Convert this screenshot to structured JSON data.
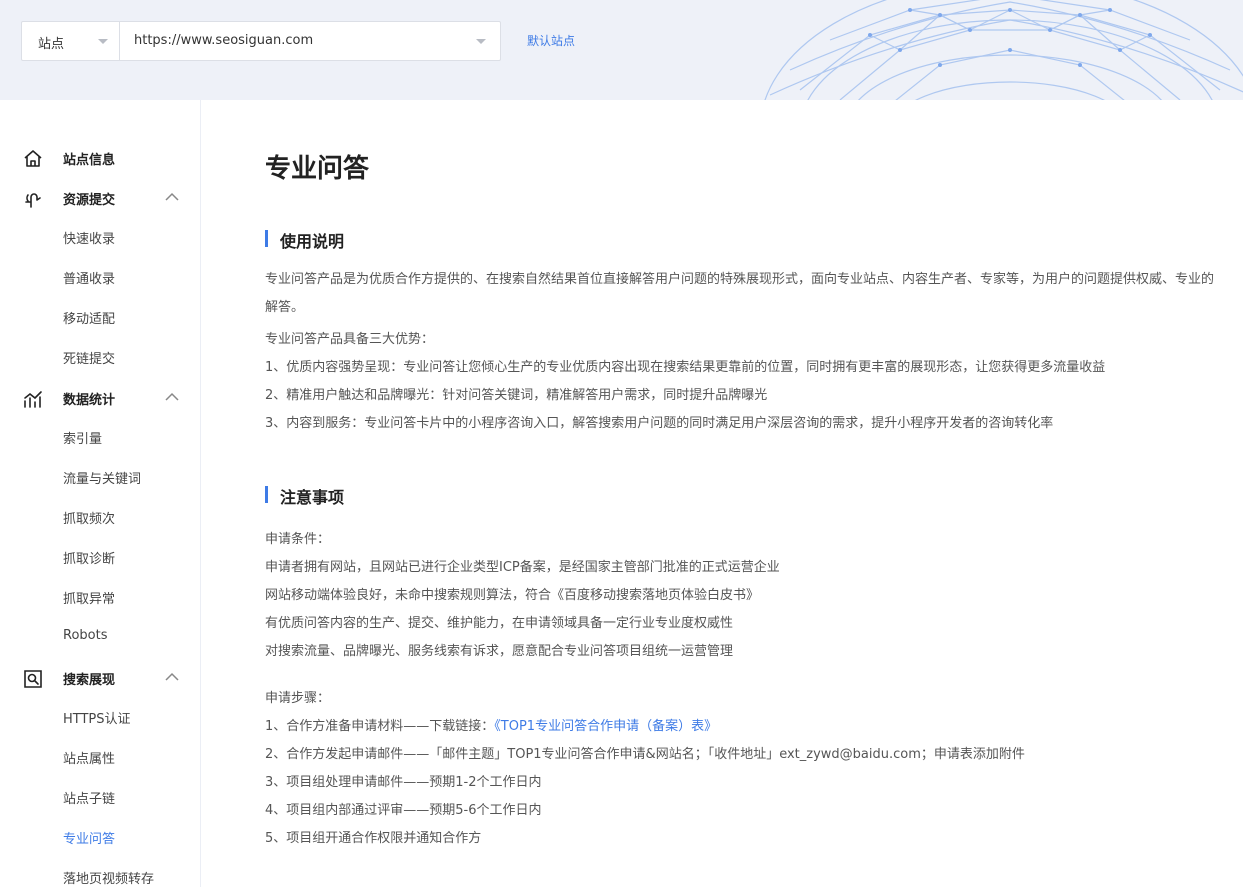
{
  "header": {
    "site_type_label": "站点",
    "site_url": "https://www.seosiguan.com",
    "default_site_link": "默认站点"
  },
  "sidebar": {
    "groups": [
      {
        "label": "站点信息",
        "icon": "home-icon",
        "expanded": null
      },
      {
        "label": "资源提交",
        "icon": "submit-icon",
        "expanded": true,
        "items": [
          "快速收录",
          "普通收录",
          "移动适配",
          "死链提交"
        ]
      },
      {
        "label": "数据统计",
        "icon": "stats-icon",
        "expanded": true,
        "items": [
          "索引量",
          "流量与关键词",
          "抓取频次",
          "抓取诊断",
          "抓取异常",
          "Robots"
        ]
      },
      {
        "label": "搜索展现",
        "icon": "search-display-icon",
        "expanded": true,
        "items": [
          "HTTPS认证",
          "站点属性",
          "站点子链",
          "专业问答",
          "落地页视频转存"
        ]
      }
    ],
    "active_item": "专业问答",
    "accent_color": "#3e7be6"
  },
  "main": {
    "title": "专业问答",
    "usage": {
      "heading": "使用说明",
      "intro": "专业问答产品是为优质合作方提供的、在搜索自然结果首位直接解答用户问题的特殊展现形式，面向专业站点、内容生产者、专家等，为用户的问题提供权威、专业的解答。",
      "advantages_title": "专业问答产品具备三大优势：",
      "advantages": [
        "1、优质内容强势呈现：专业问答让您倾心生产的专业优质内容出现在搜索结果更靠前的位置，同时拥有更丰富的展现形态，让您获得更多流量收益",
        "2、精准用户触达和品牌曝光：针对问答关键词，精准解答用户需求，同时提升品牌曝光",
        "3、内容到服务：专业问答卡片中的小程序咨询入口，解答搜索用户问题的同时满足用户深层咨询的需求，提升小程序开发者的咨询转化率"
      ]
    },
    "notes": {
      "heading": "注意事项",
      "conditions_title": "申请条件：",
      "conditions": [
        "申请者拥有网站，且网站已进行企业类型ICP备案，是经国家主管部门批准的正式运营企业",
        "网站移动端体验良好，未命中搜索规则算法，符合《百度移动搜索落地页体验白皮书》",
        "有优质问答内容的生产、提交、维护能力，在申请领域具备一定行业专业度权威性",
        "对搜索流量、品牌曝光、服务线索有诉求，愿意配合专业问答项目组统一运营管理"
      ],
      "steps_title": "申请步骤：",
      "step1_prefix": "1、合作方准备申请材料——下载链接：",
      "step1_link": "《TOP1专业问答合作申请（备案）表》",
      "steps": [
        "2、合作方发起申请邮件——「邮件主题」TOP1专业问答合作申请&网站名；「收件地址」ext_zywd@baidu.com；申请表添加附件",
        "3、项目组处理申请邮件——预期1-2个工作日内",
        "4、项目组内部通过评审——预期5-6个工作日内",
        "5、项目组开通合作权限并通知合作方"
      ]
    }
  }
}
